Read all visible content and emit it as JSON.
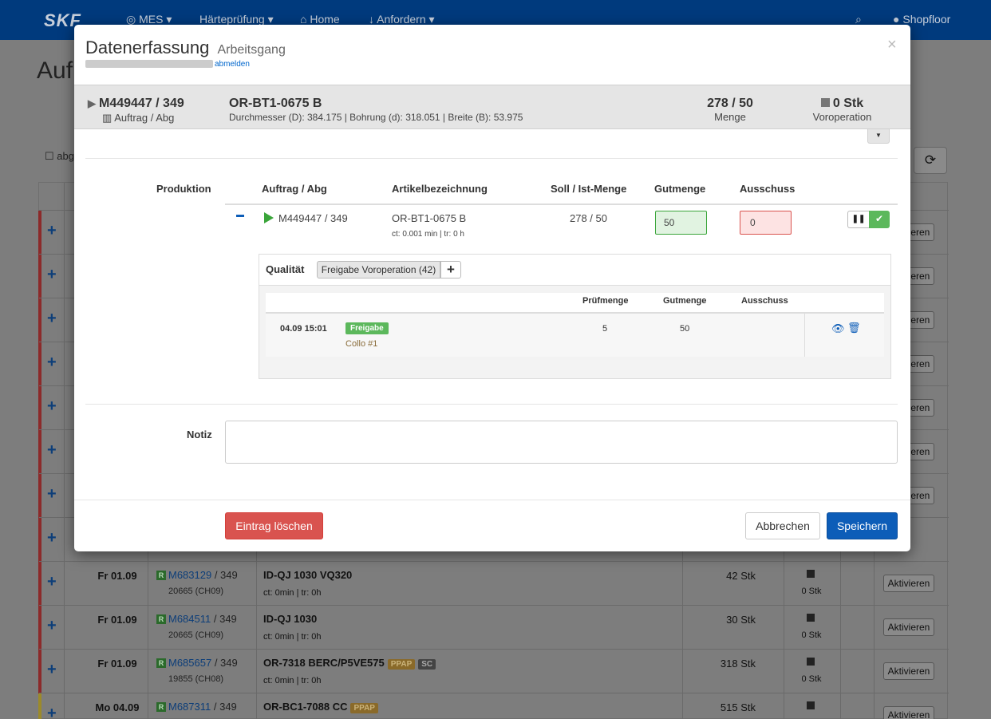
{
  "navbar": {
    "logo": "SKF",
    "items": [
      {
        "label": "◎ MES ▾"
      },
      {
        "label": "Härteprüfung ▾"
      },
      {
        "label": "⌂ Home"
      },
      {
        "label": "↓ Anfordern ▾"
      }
    ],
    "user": "Shopfloor"
  },
  "background": {
    "title": "Auf",
    "checkbox_label": "abg",
    "rows": [
      {
        "date": "Fr 01.09",
        "order": "M683129",
        "abg": " / 349",
        "sub": "20665 (CH09)",
        "article": "ID-QJ 1030 VQ320",
        "tags": [],
        "ct": "ct: 0min | tr: 0h",
        "qty": "42 Stk",
        "vor": "0 Stk",
        "action": "Aktivieren"
      },
      {
        "date": "Fr 01.09",
        "order": "M684511",
        "abg": " / 349",
        "sub": "20665 (CH09)",
        "article": "ID-QJ 1030",
        "tags": [],
        "ct": "ct: 0min | tr: 0h",
        "qty": "30 Stk",
        "vor": "0 Stk",
        "action": "Aktivieren"
      },
      {
        "date": "Fr 01.09",
        "order": "M685657",
        "abg": " / 349",
        "sub": "19855 (CH08)",
        "article": "OR-7318 BERC/P5VE575",
        "tags": [
          "PPAP",
          "SC"
        ],
        "ct": "ct: 0min | tr: 0h",
        "qty": "318 Stk",
        "vor": "0 Stk",
        "action": "Aktivieren"
      },
      {
        "date": "Mo 04.09",
        "order": "M687311",
        "abg": " / 349",
        "sub": "",
        "article": "OR-BC1-7088 CC",
        "tags": [
          "PPAP"
        ],
        "ct": "",
        "qty": "515 Stk",
        "vor": "",
        "action": "Aktivieren"
      }
    ],
    "hidden_row_actions": [
      "Aktivieren",
      "Aktivieren",
      "Aktivieren",
      "Aktivieren",
      "Aktivieren",
      "Aktivieren",
      "Aktivieren"
    ]
  },
  "modal": {
    "title": "Datenerfassung",
    "subtitle": "Arbeitsgang",
    "logout": "abmelden",
    "close": "×",
    "info": {
      "order": "M449447 / 349",
      "order_sub": "Auftrag / Abg",
      "article": "OR-BT1-0675 B",
      "dims": "Durchmesser (D): 384.175 | Bohrung (d): 318.051 | Breite (B): 53.975",
      "qty": "278 / 50",
      "qty_label": "Menge",
      "vor": "0 Stk",
      "vor_label": "Voroperation"
    },
    "production": {
      "label": "Produktion",
      "columns": [
        "Auftrag / Abg",
        "Artikelbezeichnung",
        "Soll / Ist-Menge",
        "Gutmenge",
        "Ausschuss"
      ],
      "row": {
        "order": "M449447 / 349",
        "article": "OR-BT1-0675 B",
        "article_sub": "ct: 0.001 min | tr: 0 h",
        "soll": "278 / 50",
        "gut": "50",
        "aus": "0"
      }
    },
    "quality": {
      "label": "Qualität",
      "tab": "Freigabe Voroperation (42)",
      "add": "+",
      "columns": [
        "Prüfmenge",
        "Gutmenge",
        "Ausschuss"
      ],
      "row": {
        "date": "04.09 15:01",
        "badge": "Freigabe",
        "collo": "Collo #1",
        "pruef": "5",
        "gut": "50",
        "aus": ""
      }
    },
    "notiz": {
      "label": "Notiz",
      "value": ""
    },
    "buttons": {
      "delete": "Eintrag löschen",
      "cancel": "Abbrechen",
      "save": "Speichern"
    }
  },
  "colors": {
    "navbar": "#003a7d",
    "primary": "#0d5db8",
    "success": "#5cb85c",
    "danger": "#d9534f",
    "row_marker": "#8c2a2a",
    "row_marker_warn": "#9c8a2a"
  }
}
